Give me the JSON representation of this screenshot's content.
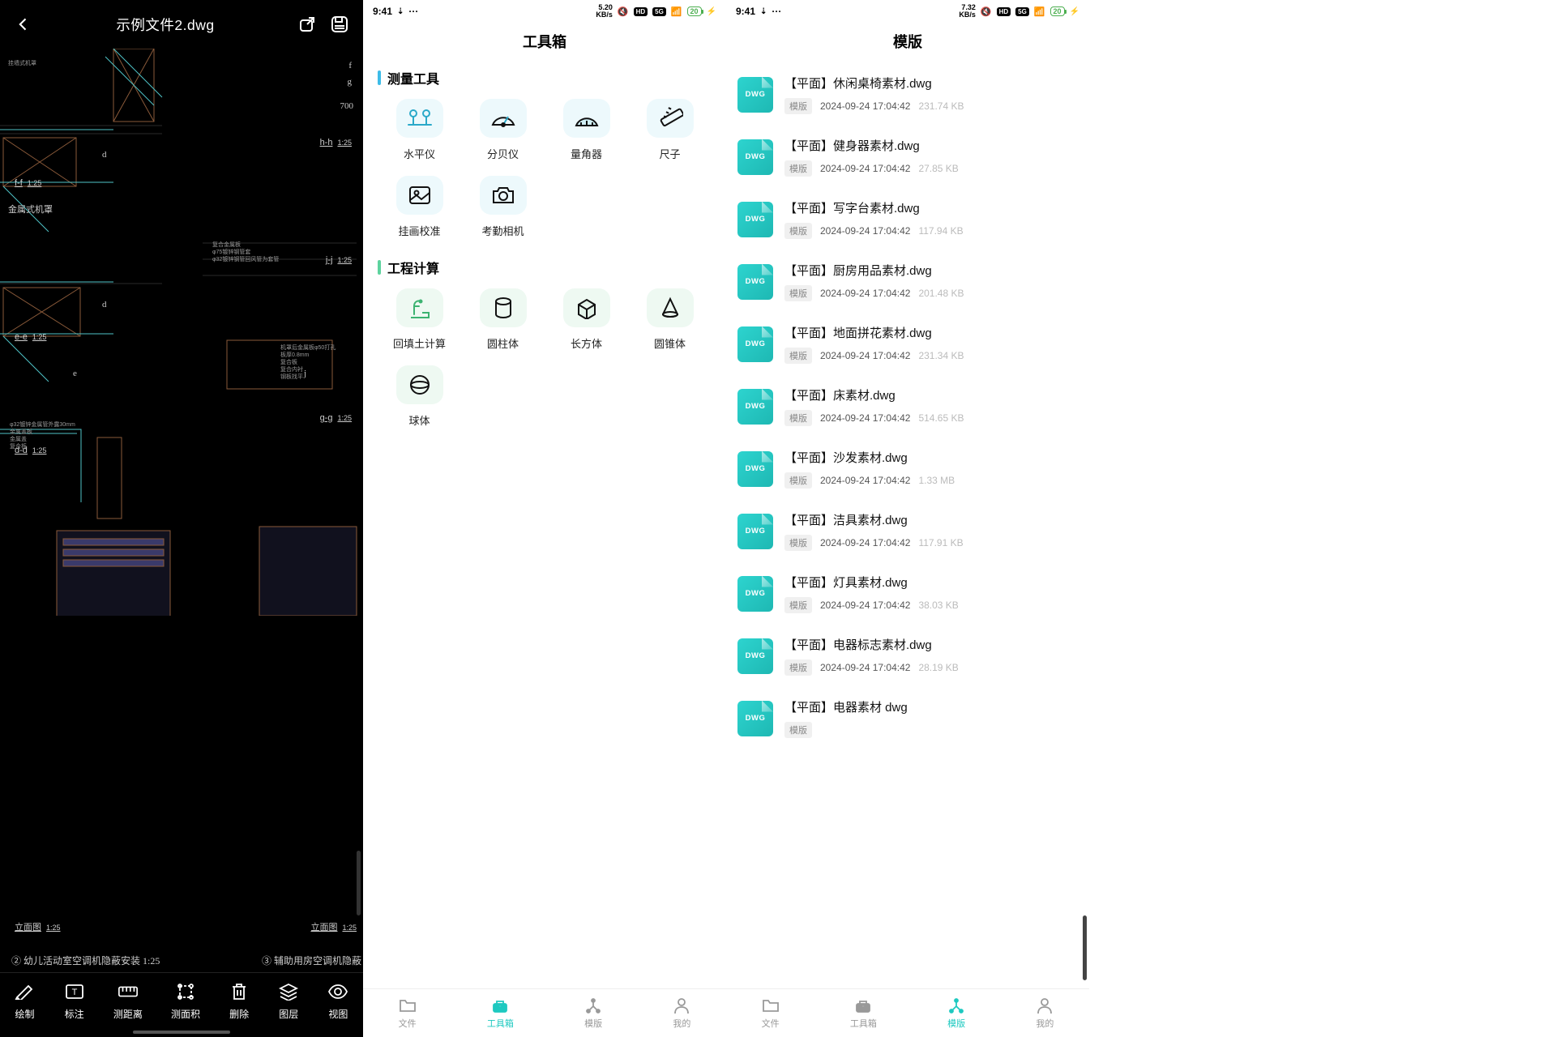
{
  "pane1": {
    "title": "示例文件2.dwg",
    "labels": {
      "hh": "h-h",
      "ff": "f-f",
      "jj": "j-j",
      "ee": "e-e",
      "gg": "g-g",
      "dd": "d-d",
      "elev1": "立面图",
      "elev2": "立面图",
      "scale": "1:25",
      "caption2": "② 幼儿活动室空调机隐蔽安装 1:25",
      "caption3": "③ 辅助用房空调机隐蔽"
    },
    "tools": [
      {
        "id": "draw",
        "label": "绘制"
      },
      {
        "id": "annotate",
        "label": "标注"
      },
      {
        "id": "measure-dist",
        "label": "测距离"
      },
      {
        "id": "measure-area",
        "label": "测面积"
      },
      {
        "id": "delete",
        "label": "删除"
      },
      {
        "id": "layers",
        "label": "图层"
      },
      {
        "id": "view",
        "label": "视图"
      }
    ]
  },
  "pane2": {
    "status_time": "9:41",
    "status_kbs": "5.20",
    "status_kbs_unit": "KB/s",
    "title": "工具箱",
    "sec_measure": "测量工具",
    "sec_calc": "工程计算",
    "measure_tools": [
      {
        "id": "level",
        "label": "水平仪"
      },
      {
        "id": "decibel",
        "label": "分贝仪"
      },
      {
        "id": "protractor",
        "label": "量角器"
      },
      {
        "id": "ruler",
        "label": "尺子"
      },
      {
        "id": "picture-align",
        "label": "挂画校准"
      },
      {
        "id": "attendance-camera",
        "label": "考勤相机"
      }
    ],
    "calc_tools": [
      {
        "id": "backfill",
        "label": "回填土计算"
      },
      {
        "id": "cylinder",
        "label": "圆柱体"
      },
      {
        "id": "cuboid",
        "label": "长方体"
      },
      {
        "id": "cone",
        "label": "圆锥体"
      },
      {
        "id": "sphere",
        "label": "球体"
      }
    ],
    "nav": [
      {
        "id": "files",
        "label": "文件"
      },
      {
        "id": "toolbox",
        "label": "工具箱"
      },
      {
        "id": "templates",
        "label": "模版"
      },
      {
        "id": "mine",
        "label": "我的"
      }
    ],
    "active_nav": "toolbox"
  },
  "pane3": {
    "status_time": "9:41",
    "status_kbs": "7.32",
    "status_kbs_unit": "KB/s",
    "title": "模版",
    "file_icon_label": "DWG",
    "tag_label": "模版",
    "files": [
      {
        "name": "【平面】休闲桌椅素材.dwg",
        "date": "2024-09-24 17:04:42",
        "size": "231.74 KB"
      },
      {
        "name": "【平面】健身器素材.dwg",
        "date": "2024-09-24 17:04:42",
        "size": "27.85 KB"
      },
      {
        "name": "【平面】写字台素材.dwg",
        "date": "2024-09-24 17:04:42",
        "size": "117.94 KB"
      },
      {
        "name": "【平面】厨房用品素材.dwg",
        "date": "2024-09-24 17:04:42",
        "size": "201.48 KB"
      },
      {
        "name": "【平面】地面拼花素材.dwg",
        "date": "2024-09-24 17:04:42",
        "size": "231.34 KB"
      },
      {
        "name": "【平面】床素材.dwg",
        "date": "2024-09-24 17:04:42",
        "size": "514.65 KB"
      },
      {
        "name": "【平面】沙发素材.dwg",
        "date": "2024-09-24 17:04:42",
        "size": "1.33 MB"
      },
      {
        "name": "【平面】洁具素材.dwg",
        "date": "2024-09-24 17:04:42",
        "size": "117.91 KB"
      },
      {
        "name": "【平面】灯具素材.dwg",
        "date": "2024-09-24 17:04:42",
        "size": "38.03 KB"
      },
      {
        "name": "【平面】电器标志素材.dwg",
        "date": "2024-09-24 17:04:42",
        "size": "28.19 KB"
      },
      {
        "name": "【平面】电器素材 dwg",
        "date": "",
        "size": ""
      }
    ],
    "nav": [
      {
        "id": "files",
        "label": "文件"
      },
      {
        "id": "toolbox",
        "label": "工具箱"
      },
      {
        "id": "templates",
        "label": "模版"
      },
      {
        "id": "mine",
        "label": "我的"
      }
    ],
    "active_nav": "templates"
  },
  "status_badges": {
    "hd": "HD",
    "fiveg": "5G",
    "bat": "20"
  }
}
